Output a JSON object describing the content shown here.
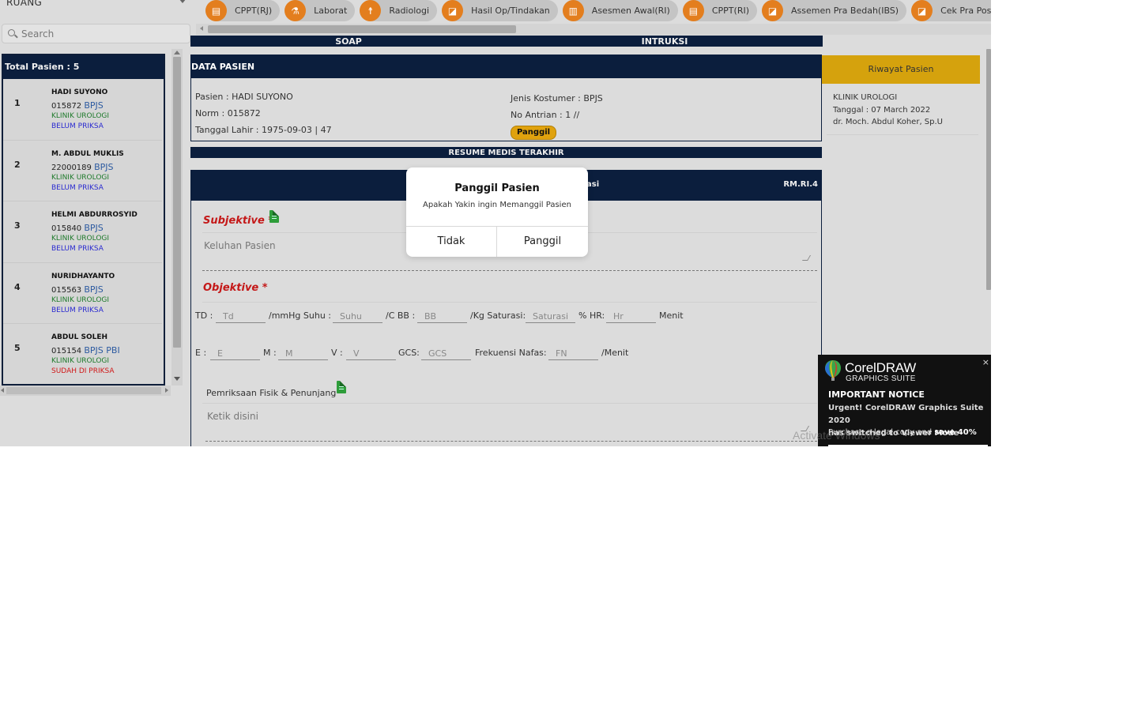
{
  "sidebar": {
    "ruang_label": "RUANG",
    "search_placeholder": "Search",
    "total_label": "Total Pasien : 5",
    "patients": [
      {
        "num": "1",
        "name": "HADI SUYONO",
        "norm": "015872",
        "insurance": "BPJS",
        "clinic": "KLINIK UROLOGI",
        "status": "BELUM PRIKSA"
      },
      {
        "num": "2",
        "name": "M. ABDUL MUKLIS",
        "norm": "22000189",
        "insurance": "BPJS",
        "clinic": "KLINIK UROLOGI",
        "status": "BELUM PRIKSA"
      },
      {
        "num": "3",
        "name": "HELMI ABDURROSYID",
        "norm": "015840",
        "insurance": "BPJS",
        "clinic": "KLINIK UROLOGI",
        "status": "BELUM PRIKSA"
      },
      {
        "num": "4",
        "name": "NURIDHAYANTO",
        "norm": "015563",
        "insurance": "BPJS",
        "clinic": "KLINIK UROLOGI",
        "status": "BELUM PRIKSA"
      },
      {
        "num": "5",
        "name": "ABDUL SOLEH",
        "norm": "015154",
        "insurance": "BPJS PBI",
        "clinic": "KLINIK UROLOGI",
        "status": "SUDAH DI PRIKSA"
      }
    ]
  },
  "toolbar": {
    "buttons": [
      "CPPT(RJ)",
      "Laborat",
      "Radiologi",
      "Hasil Op/Tindakan",
      "Asesmen Awal(RI)",
      "CPPT(RI)",
      "Assemen Pra Bedah(IBS)",
      "Cek Pra Post OP(IBS)"
    ]
  },
  "tabs": {
    "soap": "SOAP",
    "instruksi": "INTRUKSI"
  },
  "data_pasien": {
    "header": "DATA PASIEN",
    "pasien": "Pasien : HADI SUYONO",
    "norm": "Norm : 015872",
    "tgl_lahir": "Tanggal Lahir : 1975-09-03 | 47",
    "jenis_kostumer": "Jenis Kostumer : BPJS",
    "no_antrian": "No Antrian : 1 //",
    "panggil_badge": "Panggil"
  },
  "resume_bar": "RESUME MEDIS TERAKHIR",
  "soap_form": {
    "head_mid": "asi",
    "head_right": "RM.RI.4",
    "subjektive": "Subjektive",
    "required_mark": "*",
    "keluhan_placeholder": "Keluhan Pasien",
    "objektive": "Objektive",
    "vitals_row1": {
      "td_label": "TD :",
      "td_ph": "Td",
      "mmhg_suhu": "/mmHg Suhu :",
      "suhu_ph": "Suhu",
      "c_bb": "/C BB :",
      "bb_ph": "BB",
      "kg_saturasi": "/Kg Saturasi:",
      "sat_ph": "Saturasi",
      "hr": "% HR:",
      "hr_ph": "Hr",
      "menit": "Menit"
    },
    "vitals_row2": {
      "e_label": "E :",
      "e_ph": "E",
      "m_label": "M :",
      "m_ph": "M",
      "v_label": "V :",
      "v_ph": "V",
      "gcs_label": "GCS:",
      "gcs_ph": "GCS",
      "fn_label": "Frekuensi Nafas:",
      "fn_ph": "FN",
      "per_menit": "/Menit"
    },
    "pemeriksaan_label": "Pemriksaan Fisik & Penunjang",
    "pemeriksaan_placeholder": "Ketik disini"
  },
  "riwayat": {
    "button": "Riwayat Pasien",
    "clinic": "KLINIK UROLOGI",
    "tanggal": "Tanggal : 07 March 2022",
    "doctor": "dr. Moch. Abdul Koher, Sp.U"
  },
  "modal": {
    "title": "Panggil Pasien",
    "message": "Apakah Yakin ingin Memanggil Pasien",
    "cancel": "Tidak",
    "confirm": "Panggil"
  },
  "corel_popup": {
    "brand": "CorelDRAW",
    "sub": "GRAPHICS SUITE",
    "close": "×",
    "notice": "IMPORTANT NOTICE",
    "line1": "Urgent! CorelDRAW Graphics Suite 2020",
    "line2": "has switched to Viewer Mode",
    "line3_pre": "Purchase a legal copy and ",
    "line3_bold": "save 40%"
  },
  "watermark": "Activate Windows",
  "colors": {
    "navy": "#0b1e3d",
    "orange": "#e37e1e",
    "gold": "#d5a20d",
    "required_red": "#c41818"
  }
}
